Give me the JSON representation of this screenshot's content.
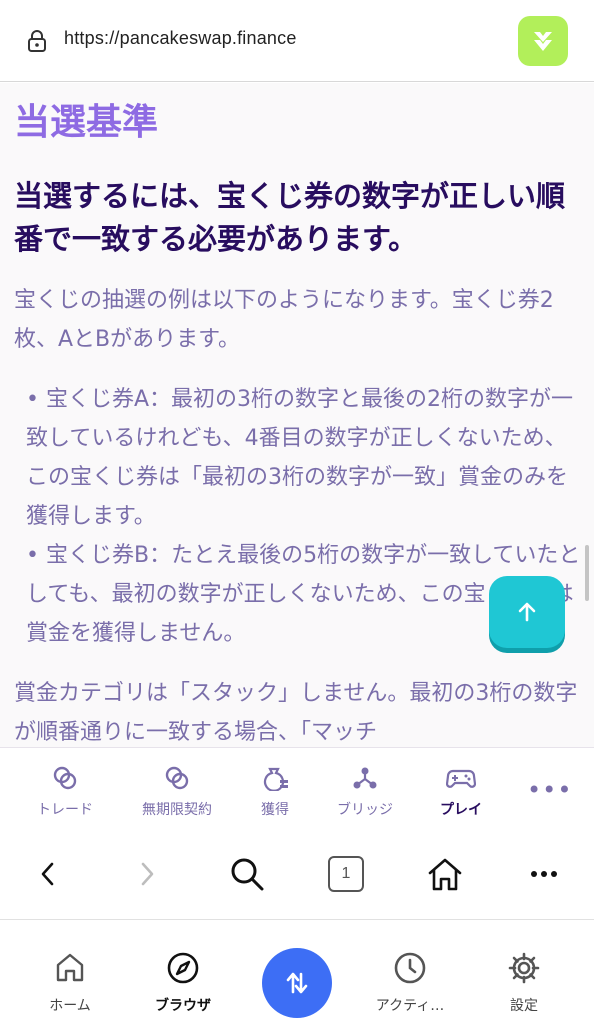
{
  "urlbar": {
    "url": "https://pancakeswap.finance"
  },
  "content": {
    "section_heading": "当選基準",
    "main_heading": "当選するには、宝くじ券の数字が正しい順番で一致する必要があります。",
    "paragraph1": "宝くじの抽選の例は以下のようになります。宝くじ券2枚、AとBがあります。",
    "bullets": [
      "宝くじ券A：最初の3桁の数字と最後の2桁の数字が一致しているけれども、4番目の数字が正しくないため、この宝くじ券は「最初の3桁の数字が一致」賞金のみを獲得します。",
      "宝くじ券B：たとえ最後の5桁の数字が一致していたとしても、最初の数字が正しくないため、この宝くじ券は賞金を獲得しません。"
    ],
    "paragraph2": "賞金カテゴリは「スタック」しません。最初の3桁の数字が順番通りに一致する場合、「マッチ"
  },
  "app_nav": {
    "items": [
      {
        "label": "トレード",
        "icon": "trade-icon"
      },
      {
        "label": "無期限契約",
        "icon": "perpetual-icon"
      },
      {
        "label": "獲得",
        "icon": "earn-icon"
      },
      {
        "label": "ブリッジ",
        "icon": "bridge-icon"
      },
      {
        "label": "プレイ",
        "icon": "game-controller-icon",
        "active": true
      }
    ],
    "more": "•••"
  },
  "browser_toolbar": {
    "tab_count": "1"
  },
  "tab_bar": {
    "items": [
      {
        "label": "ホーム",
        "icon": "home-icon"
      },
      {
        "label": "ブラウザ",
        "icon": "compass-icon",
        "active": true
      },
      {
        "label": "アクティ…",
        "icon": "clock-icon"
      },
      {
        "label": "設定",
        "icon": "gear-icon"
      }
    ],
    "swap_icon": "swap-arrows-icon"
  },
  "colors": {
    "heading_purple": "#8e6be3",
    "text_dark": "#280d5f",
    "text_muted": "#7a6eaa",
    "fab": "#1fc7d4",
    "wallet_green": "#b2ef5a",
    "swap_blue": "#3d6ef5"
  }
}
